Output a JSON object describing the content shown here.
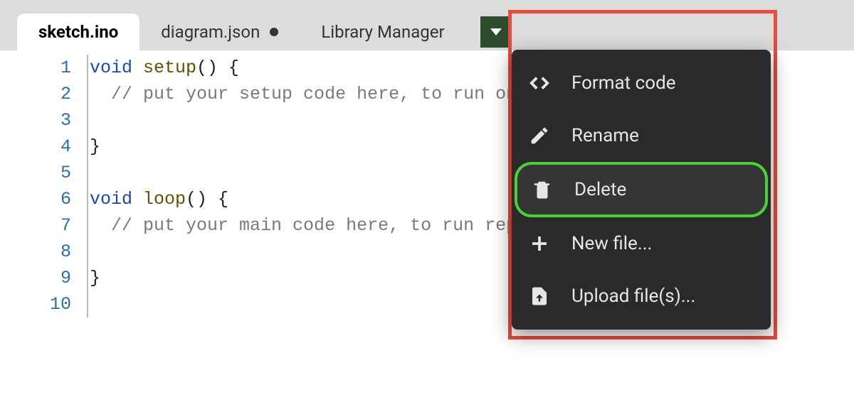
{
  "tabs": [
    {
      "label": "sketch.ino",
      "active": true,
      "dirty": false
    },
    {
      "label": "diagram.json",
      "active": false,
      "dirty": true
    },
    {
      "label": "Library Manager",
      "active": false,
      "dirty": false
    }
  ],
  "editor": {
    "lines": [
      {
        "n": "1",
        "indent": "",
        "tokens": [
          [
            "kw",
            "void"
          ],
          [
            "",
            " "
          ],
          [
            "fn",
            "setup"
          ],
          [
            "",
            "() {"
          ]
        ]
      },
      {
        "n": "2",
        "indent": "  ",
        "tokens": [
          [
            "cm",
            "// put your setup code here, to run once:"
          ]
        ]
      },
      {
        "n": "3",
        "indent": "",
        "tokens": []
      },
      {
        "n": "4",
        "indent": "",
        "tokens": [
          [
            "",
            "}"
          ]
        ]
      },
      {
        "n": "5",
        "indent": "",
        "tokens": []
      },
      {
        "n": "6",
        "indent": "",
        "tokens": [
          [
            "kw",
            "void"
          ],
          [
            "",
            " "
          ],
          [
            "fn",
            "loop"
          ],
          [
            "",
            "() {"
          ]
        ]
      },
      {
        "n": "7",
        "indent": "  ",
        "tokens": [
          [
            "cm",
            "// put your main code here, to run repeatedly:"
          ]
        ]
      },
      {
        "n": "8",
        "indent": "",
        "tokens": []
      },
      {
        "n": "9",
        "indent": "",
        "tokens": [
          [
            "",
            "}"
          ]
        ]
      },
      {
        "n": "10",
        "indent": "",
        "tokens": []
      }
    ]
  },
  "menu": {
    "items": [
      {
        "icon": "code-icon",
        "label": "Format code",
        "highlight": false
      },
      {
        "icon": "pencil-icon",
        "label": "Rename",
        "highlight": false
      },
      {
        "icon": "trash-icon",
        "label": "Delete",
        "highlight": true
      },
      {
        "icon": "plus-icon",
        "label": "New file...",
        "highlight": false
      },
      {
        "icon": "upload-icon",
        "label": "Upload file(s)...",
        "highlight": false
      }
    ]
  }
}
